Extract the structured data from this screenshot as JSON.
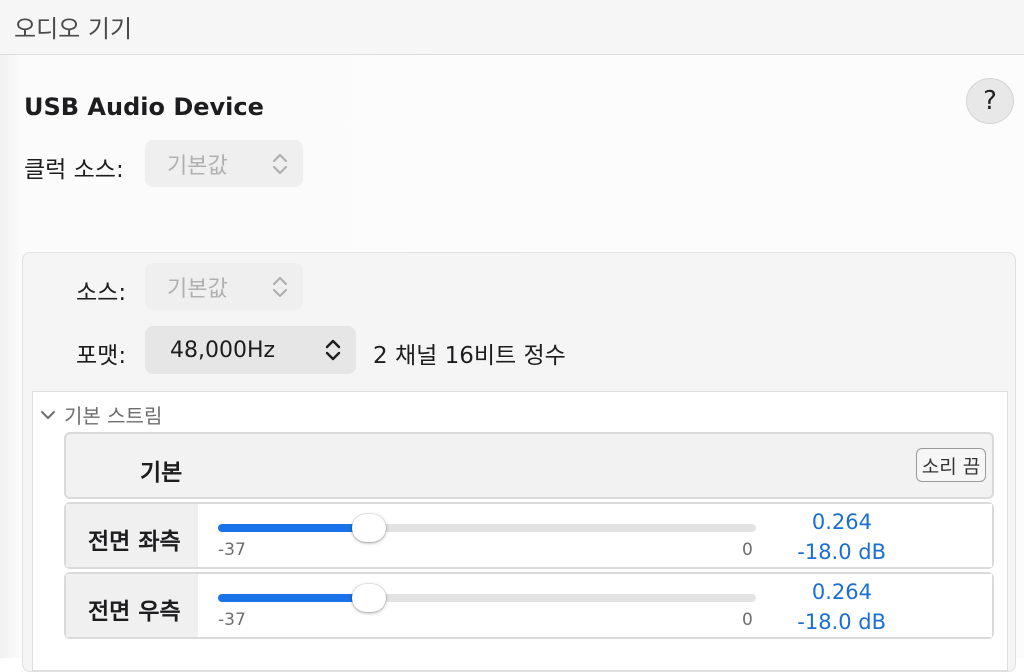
{
  "window": {
    "title": "오디오 기기"
  },
  "help": {
    "label": "?"
  },
  "device": {
    "name": "USB Audio Device",
    "clock_source_label": "클럭 소스:",
    "clock_source_value": "기본값"
  },
  "stream": {
    "source_label": "소스:",
    "source_value": "기본값",
    "format_label": "포맷:",
    "format_value": "48,000Hz",
    "format_description": "2 채널 16비트 정수",
    "section_title": "기본 스트림",
    "master": {
      "title": "기본",
      "mute_label": "소리 끔"
    },
    "channels": [
      {
        "name": "전면 좌측",
        "min_label": "-37",
        "max_label": "0",
        "level_fraction": 0.28,
        "value": "0.264",
        "db": "-18.0 dB"
      },
      {
        "name": "전면 우측",
        "min_label": "-37",
        "max_label": "0",
        "level_fraction": 0.28,
        "value": "0.264",
        "db": "-18.0 dB"
      }
    ]
  },
  "colors": {
    "accent": "#1a73e8",
    "value_text": "#1a6fd4"
  }
}
